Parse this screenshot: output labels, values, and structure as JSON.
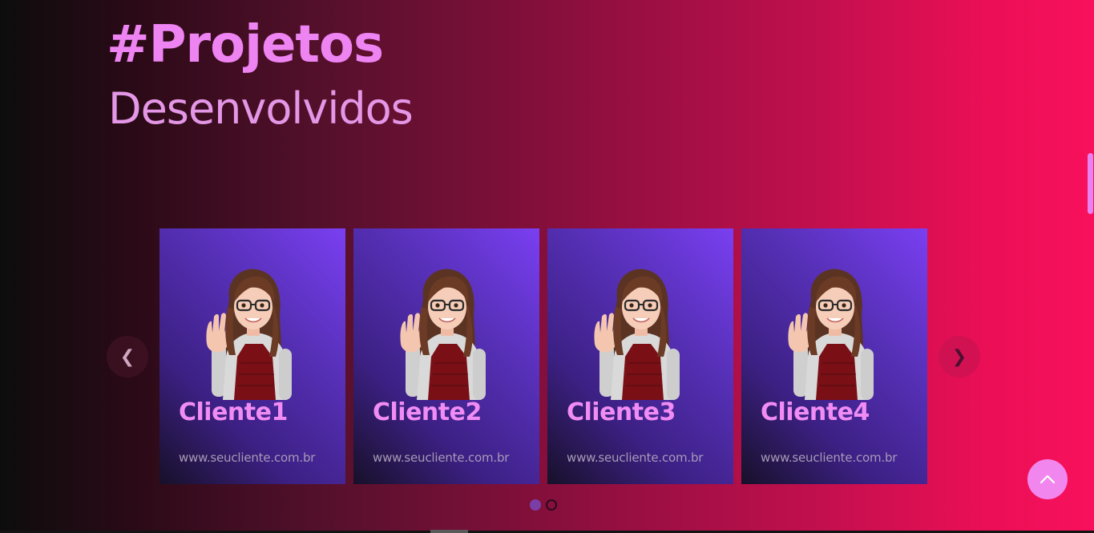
{
  "hero": {
    "title": "#Projetos",
    "subtitle": "Desenvolvidos"
  },
  "carousel": {
    "prev_icon": "chevron-left-icon",
    "prev_glyph": "❮",
    "next_icon": "chevron-right-icon",
    "next_glyph": "❯",
    "active_dot": 1,
    "dot_count": 2,
    "cards": [
      {
        "name": "Cliente1",
        "url": "www.seucliente.com.br",
        "image": "avatar-waving-girl"
      },
      {
        "name": "Cliente2",
        "url": "www.seucliente.com.br",
        "image": "avatar-waving-girl"
      },
      {
        "name": "Cliente3",
        "url": "www.seucliente.com.br",
        "image": "avatar-waving-girl"
      },
      {
        "name": "Cliente4",
        "url": "www.seucliente.com.br",
        "image": "avatar-waving-girl"
      }
    ]
  },
  "scroll_top": {
    "icon": "chevron-up-icon"
  },
  "colors": {
    "accent_pink": "#ee83f2",
    "card_gradient_top": "#7a3ff2",
    "card_gradient_bottom": "#171029",
    "background_end": "#f8105c"
  }
}
